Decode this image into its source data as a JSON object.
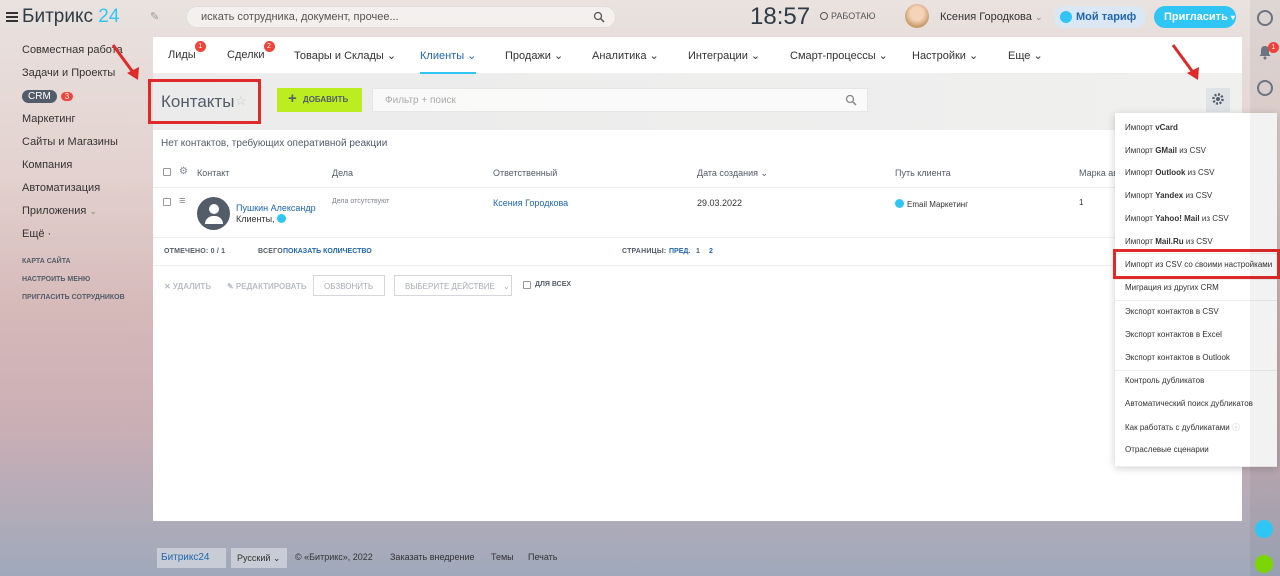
{
  "header": {
    "logo": "Битрикс",
    "logo_num": "24",
    "search_placeholder": "искать сотрудника, документ, прочее...",
    "clock": "18:57",
    "status": "РАБОТАЮ",
    "user_name": "Ксения Городкова",
    "tariff": "Мой тариф",
    "invite": "Пригласить"
  },
  "sidebar": {
    "items": [
      {
        "label": "Совместная работа"
      },
      {
        "label": "Задачи и Проекты"
      },
      {
        "label": "CRM",
        "count": "3"
      },
      {
        "label": "Маркетинг"
      },
      {
        "label": "Сайты и Магазины"
      },
      {
        "label": "Компания"
      },
      {
        "label": "Автоматизация"
      },
      {
        "label": "Приложения"
      },
      {
        "label": "Ещё ·"
      }
    ],
    "small": [
      "КАРТА САЙТА",
      "НАСТРОИТЬ МЕНЮ",
      "ПРИГЛАСИТЬ СОТРУДНИКОВ"
    ]
  },
  "nav": {
    "tabs": [
      {
        "label": "Лиды",
        "badge": "1"
      },
      {
        "label": "Сделки",
        "badge": "2"
      },
      {
        "label": "Товары и Склады ⌄"
      },
      {
        "label": "Клиенты ⌄"
      },
      {
        "label": "Продажи ⌄"
      },
      {
        "label": "Аналитика ⌄"
      },
      {
        "label": "Интеграции ⌄"
      },
      {
        "label": "Смарт-процессы ⌄"
      },
      {
        "label": "Настройки ⌄"
      },
      {
        "label": "Еще ⌄"
      }
    ]
  },
  "page": {
    "title": "Контакты",
    "add": "ДОБАВИТЬ",
    "filter_placeholder": "Фильтр + поиск",
    "no_contacts": "Нет контактов, требующих оперативной реакции"
  },
  "table": {
    "headers": [
      "Контакт",
      "Дела",
      "Ответственный",
      "Дата создания ⌄",
      "Путь клиента",
      "Марка ав"
    ],
    "row": {
      "name": "Пушкин Александр",
      "type": "Клиенты,",
      "deals": "Дела отсутствуют",
      "responsible": "Ксения Городкова",
      "date": "29.03.2022",
      "path": "Email Маркетинг",
      "mark": "1"
    },
    "footer": {
      "selected": "ОТМЕЧЕНО: 0 / 1",
      "total_label": "ВСЕГО:",
      "total_link": "ПОКАЗАТЬ КОЛИЧЕСТВО",
      "pages_label": "СТРАНИЦЫ:",
      "prev": "ПРЕД.",
      "p1": "1",
      "p2": "2"
    }
  },
  "actions": {
    "delete": "✕ УДАЛИТЬ",
    "edit": "✎ РЕДАКТИРОВАТЬ",
    "call": "ОБЗВОНИТЬ",
    "choose": "ВЫБЕРИТЕ ДЕЙСТВИЕ",
    "forall": "ДЛЯ ВСЕХ"
  },
  "menu": [
    {
      "pre": "Импорт ",
      "bold": "vCard",
      "post": ""
    },
    {
      "pre": "Импорт ",
      "bold": "GMail",
      "post": " из CSV"
    },
    {
      "pre": "Импорт ",
      "bold": "Outlook",
      "post": " из CSV"
    },
    {
      "pre": "Импорт ",
      "bold": "Yandex",
      "post": " из CSV"
    },
    {
      "pre": "Импорт ",
      "bold": "Yahoo! Mail",
      "post": " из CSV"
    },
    {
      "pre": "Импорт ",
      "bold": "Mail.Ru",
      "post": " из CSV"
    },
    {
      "pre": "Импорт из CSV со своими настройками",
      "bold": "",
      "post": ""
    },
    {
      "pre": "Миграция из других CRM",
      "bold": "",
      "post": ""
    },
    {
      "pre": "Экспорт контактов в CSV",
      "bold": "",
      "post": ""
    },
    {
      "pre": "Экспорт контактов в Excel",
      "bold": "",
      "post": ""
    },
    {
      "pre": "Экспорт контактов в Outlook",
      "bold": "",
      "post": ""
    },
    {
      "pre": "Контроль дубликатов",
      "bold": "",
      "post": ""
    },
    {
      "pre": "Автоматический поиск дубликатов",
      "bold": "",
      "post": ""
    },
    {
      "pre": "Как работать с дубликатами",
      "bold": "",
      "post": ""
    },
    {
      "pre": "Отраслевые сценарии",
      "bold": "",
      "post": ""
    }
  ],
  "footer": {
    "logo": "Битрикс24",
    "lang": "Русский ⌄",
    "copyright": "© «Битрикс», 2022",
    "order": "Заказать внедрение",
    "themes": "Темы",
    "print": "Печать"
  },
  "right_badge": "1",
  "colors": {
    "accent": "#2fc6f6",
    "link": "#2067b0",
    "add": "#bbed21",
    "highlight": "#e02a2a"
  }
}
